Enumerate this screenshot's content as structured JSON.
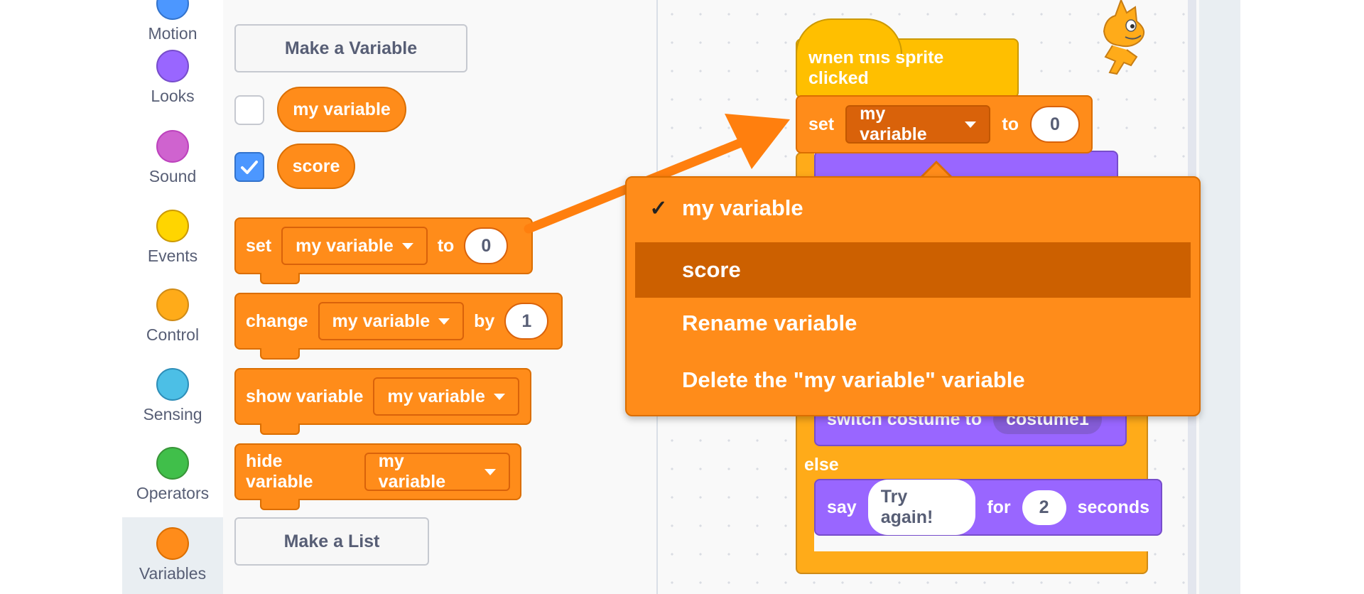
{
  "categories": [
    {
      "label": "Motion",
      "color": "#4c97ff"
    },
    {
      "label": "Looks",
      "color": "#9966ff"
    },
    {
      "label": "Sound",
      "color": "#cf63cf"
    },
    {
      "label": "Events",
      "color": "#ffd500"
    },
    {
      "label": "Control",
      "color": "#ffab19"
    },
    {
      "label": "Sensing",
      "color": "#4cbfe6"
    },
    {
      "label": "Operators",
      "color": "#40bf4a"
    },
    {
      "label": "Variables",
      "color": "#ff8c1a"
    }
  ],
  "palette": {
    "make_variable_label": "Make a Variable",
    "variables": [
      {
        "name": "my variable",
        "checked": false
      },
      {
        "name": "score",
        "checked": true
      }
    ],
    "set_block": {
      "verb": "set",
      "dropdown": "my variable",
      "to": "to",
      "value": "0"
    },
    "change_block": {
      "verb": "change",
      "dropdown": "my variable",
      "by": "by",
      "value": "1"
    },
    "show_block": {
      "verb": "show variable",
      "dropdown": "my variable"
    },
    "hide_block": {
      "verb": "hide variable",
      "dropdown": "my variable"
    },
    "make_list_label": "Make a List"
  },
  "workspace": {
    "hat_label": "when this sprite clicked",
    "set_block": {
      "verb": "set",
      "dropdown": "my variable",
      "to": "to",
      "value": "0"
    },
    "switch_text": "switch costume to",
    "switch_value": "costume1",
    "else_label": "else",
    "say_block": {
      "verb": "say",
      "message": "Try again!",
      "for": "for",
      "value": "2",
      "unit": "seconds"
    }
  },
  "dropdown_menu": {
    "items": [
      {
        "label": "my variable",
        "checkmark": "✓",
        "highlighted": false
      },
      {
        "label": "score",
        "checkmark": "",
        "highlighted": true
      },
      {
        "label": "Rename variable",
        "checkmark": "",
        "highlighted": false
      },
      {
        "label": "Delete the \"my variable\" variable",
        "checkmark": "",
        "highlighted": false
      }
    ]
  },
  "colors": {
    "variables_block": "#ff8c1a",
    "variables_border": "#db6e00",
    "looks_block": "#9966ff",
    "control_block": "#ffab19",
    "events_block": "#ffbf00",
    "checkbox_checked": "#4c97ff",
    "annotation_arrow": "#ff7f0e"
  }
}
